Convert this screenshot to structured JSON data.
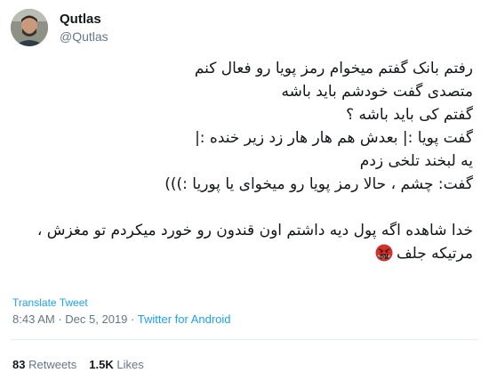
{
  "user": {
    "display_name": "Qutlas",
    "handle": "@Qutlas"
  },
  "tweet_lines": [
    "رفتم بانک گفتم میخوام رمز پویا رو فعال کنم",
    "متصدی گفت خودشم باید باشه",
    "گفتم کی باید باشه ؟",
    "گفت پویا :| بعدش هم هار هار زد زیر خنده :|",
    "یه لبخند تلخی زدم",
    "گفت: چشم ، حالا رمز پویا رو میخوای یا پوریا :)))",
    "",
    "خدا شاهده اگه پول دیه داشتم اون قندون رو خورد میکردم تو مغزش ،",
    "مرتیکه جلف"
  ],
  "emoji": "angry-face-with-symbols-icon",
  "translate_label": "Translate Tweet",
  "time": "8:43 AM",
  "separator": "·",
  "date": "Dec 5, 2019",
  "source": "Twitter for Android",
  "retweets_count": "83",
  "retweets_label": "Retweets",
  "likes_count": "1.5K",
  "likes_label": "Likes",
  "colors": {
    "link": "#1da1f2",
    "muted": "#657786",
    "emoji_red": "#d0312d"
  }
}
